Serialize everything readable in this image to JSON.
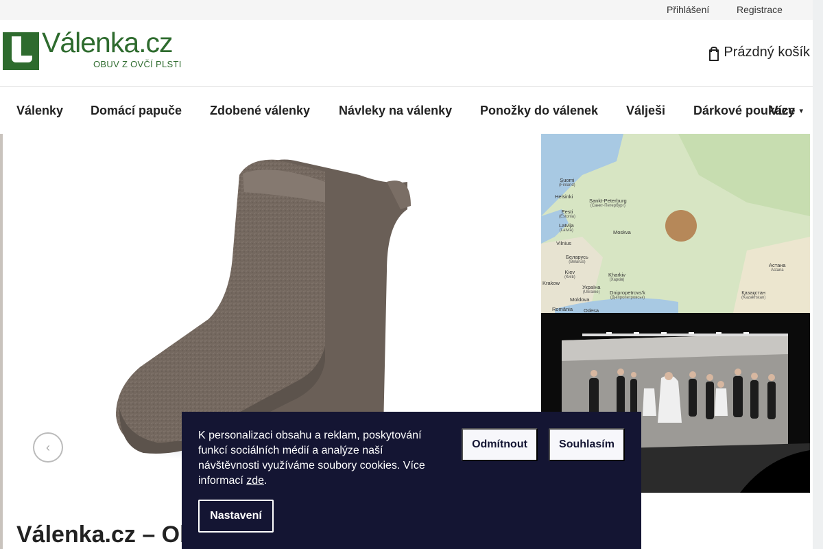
{
  "topbar": {
    "login": "Přihlášení",
    "register": "Registrace"
  },
  "logo": {
    "name": "Válenka.cz",
    "tagline": "OBUV Z OVČÍ PLSTI"
  },
  "cart": {
    "label": "Prázdný košík"
  },
  "nav": {
    "items": [
      "Válenky",
      "Domácí papuče",
      "Zdobené válenky",
      "Návleky na válenky",
      "Ponožky do válenek",
      "Válješi",
      "Dárkové poukazy"
    ],
    "more": "Více"
  },
  "map": {
    "labels": [
      {
        "name": "Suomi",
        "sub": "(Finland)"
      },
      {
        "name": "Helsinki",
        "sub": ""
      },
      {
        "name": "Sankt-Peterburg",
        "sub": "(Санкт-Петербург)"
      },
      {
        "name": "Eesti",
        "sub": "(Estonia)"
      },
      {
        "name": "Latvija",
        "sub": "(Latvia)"
      },
      {
        "name": "Moskva",
        "sub": ""
      },
      {
        "name": "Vilnius",
        "sub": ""
      },
      {
        "name": "Беларусь",
        "sub": "(Belarus)"
      },
      {
        "name": "Kiev",
        "sub": "(Київ)"
      },
      {
        "name": "Kharkiv",
        "sub": "(Харків)"
      },
      {
        "name": "Україна",
        "sub": "(Ukraine)"
      },
      {
        "name": "Krakow",
        "sub": ""
      },
      {
        "name": "Dnipropetrovs'k",
        "sub": "(Дніпропетровськ)"
      },
      {
        "name": "Moldova",
        "sub": ""
      },
      {
        "name": "România",
        "sub": ""
      },
      {
        "name": "Odesa",
        "sub": ""
      },
      {
        "name": "Астана",
        "sub": "Astana"
      },
      {
        "name": "Қазақстан",
        "sub": "(Kazakhstan)"
      }
    ]
  },
  "page_title": "Válenka.cz – Ob",
  "cookie": {
    "text": "K personalizaci obsahu a reklam, poskytování funkcí sociálních médií a analýze naší návštěvnosti využíváme soubory cookies. Více informací ",
    "link": "zde",
    "after": ".",
    "decline": "Odmítnout",
    "accept": "Souhlasím",
    "settings": "Nastavení"
  }
}
